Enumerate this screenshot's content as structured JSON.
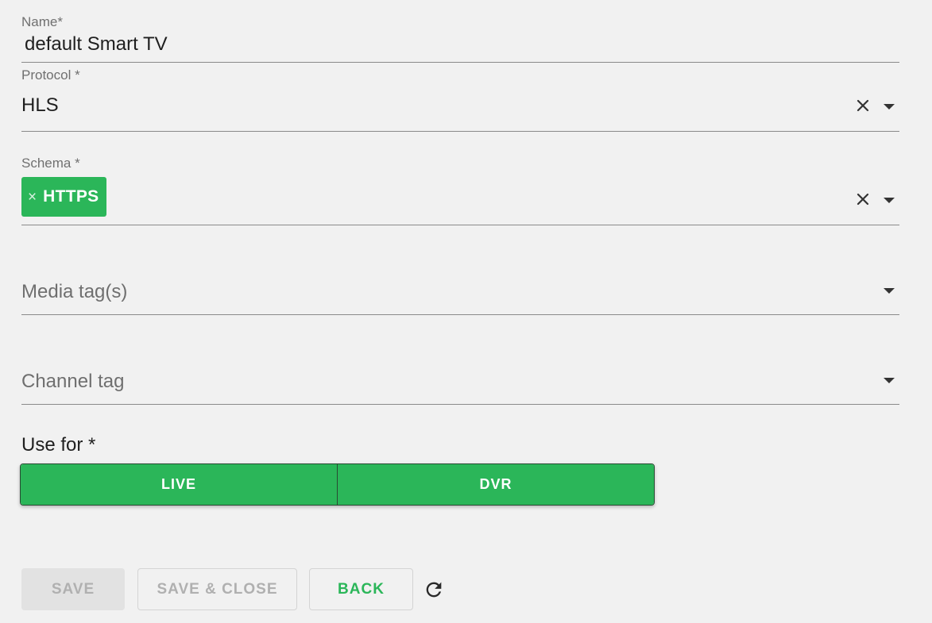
{
  "name_field": {
    "label": "Name*",
    "value": "default Smart TV"
  },
  "protocol_field": {
    "label": "Protocol *",
    "value": "HLS"
  },
  "schema_field": {
    "label": "Schema *",
    "chips": [
      {
        "remove_glyph": "×",
        "label": "HTTPS"
      }
    ]
  },
  "media_tags_field": {
    "placeholder": "Media tag(s)"
  },
  "channel_tag_field": {
    "placeholder": "Channel tag"
  },
  "use_for": {
    "label": "Use for *",
    "options": [
      "LIVE",
      "DVR"
    ]
  },
  "actions": {
    "save_label": "SAVE",
    "save_close_label": "SAVE & CLOSE",
    "back_label": "BACK"
  },
  "icons": {
    "clear": "close-icon",
    "dropdown": "caret-down-icon",
    "refresh": "refresh-icon"
  },
  "colors": {
    "background": "#f1f1f1",
    "accent": "#2bb659",
    "label_gray": "#707070",
    "disabled_text": "#b0b0b0",
    "disabled_bg": "#e2e2e2"
  }
}
